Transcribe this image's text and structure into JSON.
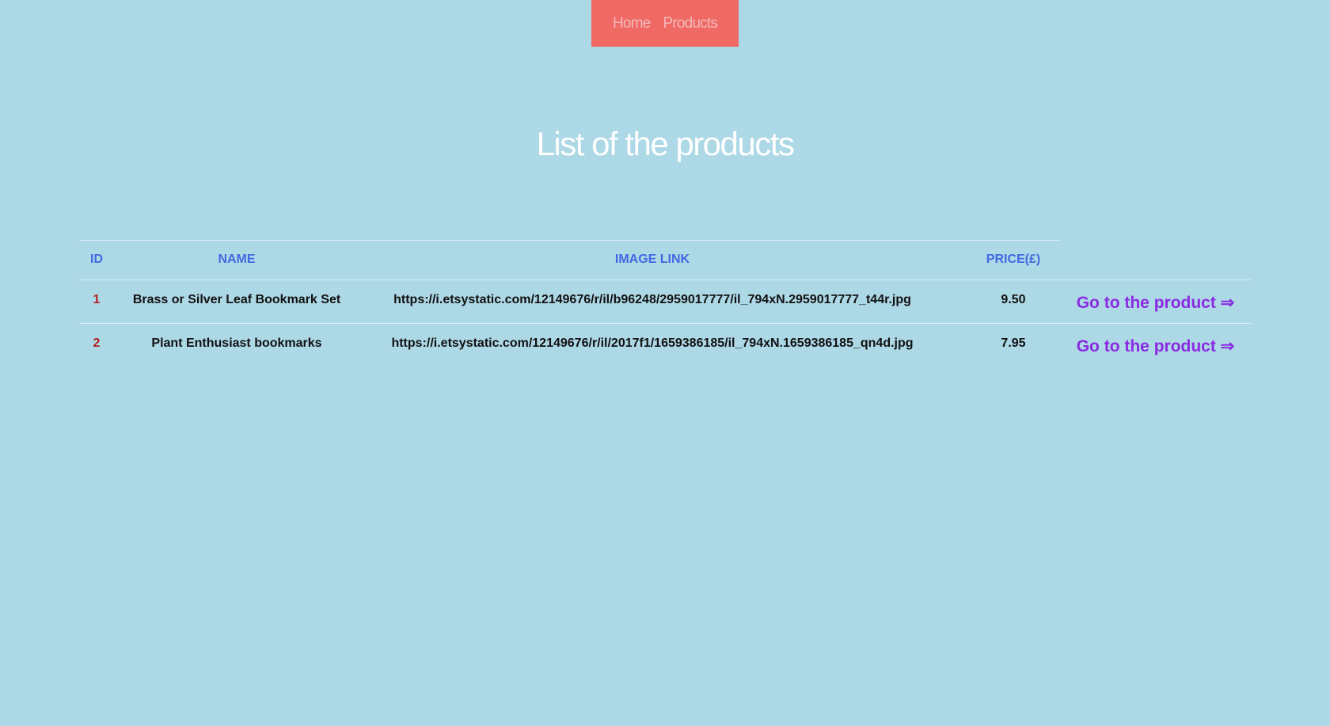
{
  "nav": {
    "home": "Home",
    "products": "Products"
  },
  "page_title": "List of the products",
  "table": {
    "headers": {
      "id": "ID",
      "name": "NAME",
      "image_link": "IMAGE LINK",
      "price": "PRICE(£)"
    },
    "rows": [
      {
        "id": "1",
        "name": "Brass or Silver Leaf Bookmark Set",
        "image_link": "https://i.etsystatic.com/12149676/r/il/b96248/2959017777/il_794xN.2959017777_t44r.jpg",
        "price": "9.50",
        "link": "Go to the product ⇒"
      },
      {
        "id": "2",
        "name": "Plant Enthusiast bookmarks",
        "image_link": "https://i.etsystatic.com/12149676/r/il/2017f1/1659386185/il_794xN.1659386185_qn4d.jpg",
        "price": "7.95",
        "link": "Go to the product ⇒"
      }
    ]
  },
  "colors": {
    "background": "#add8e6",
    "nav_background": "#f06a65",
    "header_text": "#4169e1",
    "id_text": "#b22222",
    "link_text": "#8a2be2"
  }
}
